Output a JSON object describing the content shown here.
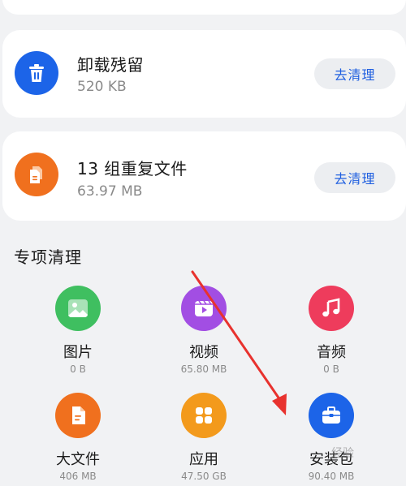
{
  "cards": [
    {
      "title": "卸载残留",
      "sub": "520 KB",
      "button": "去清理",
      "icon": "trash-icon",
      "color": "#1c64e8"
    },
    {
      "title": "13 组重复文件",
      "sub": "63.97 MB",
      "button": "去清理",
      "icon": "duplicate-files-icon",
      "color": "#f0701e"
    }
  ],
  "section": {
    "title": "专项清理"
  },
  "grid": [
    {
      "label": "图片",
      "size": "0 B",
      "icon": "image-icon",
      "color": "#3fbf60"
    },
    {
      "label": "视频",
      "size": "65.80 MB",
      "icon": "video-icon",
      "color": "#a24ee3"
    },
    {
      "label": "音频",
      "size": "0 B",
      "icon": "music-icon",
      "color": "#ee3c5c"
    },
    {
      "label": "大文件",
      "size": "406 MB",
      "icon": "file-icon",
      "color": "#f0701e"
    },
    {
      "label": "应用",
      "size": "47.50 GB",
      "icon": "apps-icon",
      "color": "#f39a1c"
    },
    {
      "label": "安装包",
      "size": "90.40 MB",
      "icon": "briefcase-icon",
      "color": "#1c64e8"
    }
  ],
  "watermark": "经验"
}
